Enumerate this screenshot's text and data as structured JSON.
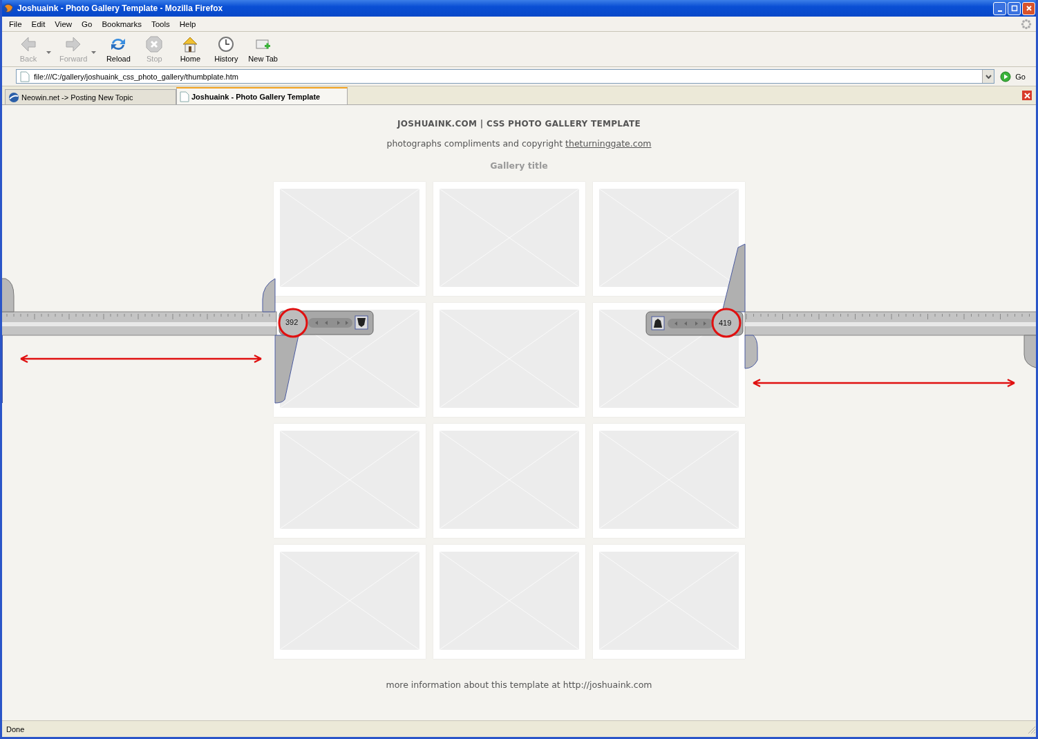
{
  "window": {
    "title": "Joshuaink - Photo Gallery Template - Mozilla Firefox"
  },
  "menu": [
    "File",
    "Edit",
    "View",
    "Go",
    "Bookmarks",
    "Tools",
    "Help"
  ],
  "toolbar": [
    {
      "kind": "back",
      "label": "Back",
      "disabled": true
    },
    {
      "kind": "forward",
      "label": "Forward",
      "disabled": true
    },
    {
      "kind": "reload",
      "label": "Reload",
      "disabled": false
    },
    {
      "kind": "stop",
      "label": "Stop",
      "disabled": true
    },
    {
      "kind": "home",
      "label": "Home",
      "disabled": false
    },
    {
      "kind": "history",
      "label": "History",
      "disabled": false
    },
    {
      "kind": "newtab",
      "label": "New Tab",
      "disabled": false
    }
  ],
  "address": {
    "value": "file:///C:/gallery/joshuaink_css_photo_gallery/thumbplate.htm",
    "go": "Go"
  },
  "tabs": [
    {
      "label": "Neowin.net -> Posting New Topic",
      "selected": false
    },
    {
      "label": "Joshuaink - Photo Gallery Template",
      "selected": true
    }
  ],
  "page": {
    "heading": "JOSHUAINK.COM | CSS PHOTO GALLERY TEMPLATE",
    "credit": "photographs compliments and copyright",
    "credit_link": "theturninggate.com",
    "gallery_title": "Gallery title",
    "footer": "more information about this template at http://joshuaink.com"
  },
  "calipers": [
    {
      "reading": "392"
    },
    {
      "reading": "419"
    }
  ],
  "status_bar": "Done"
}
